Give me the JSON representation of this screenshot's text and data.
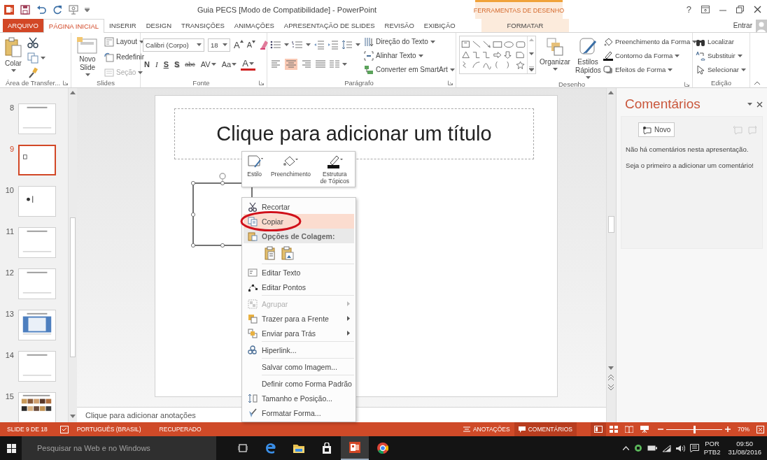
{
  "window": {
    "title": "Guia PECS [Modo de Compatibilidade] - PowerPoint",
    "help": "?",
    "account": "Entrar"
  },
  "contextual_group": {
    "label": "FERRAMENTAS DE DESENHO"
  },
  "tabs": [
    {
      "label": "ARQUIVO",
      "kind": "file",
      "selected": false
    },
    {
      "label": "PÁGINA INICIAL",
      "kind": "tab",
      "selected": true
    },
    {
      "label": "INSERIR",
      "kind": "tab",
      "selected": false
    },
    {
      "label": "DESIGN",
      "kind": "tab",
      "selected": false
    },
    {
      "label": "TRANSIÇÕES",
      "kind": "tab",
      "selected": false
    },
    {
      "label": "ANIMAÇÕES",
      "kind": "tab",
      "selected": false
    },
    {
      "label": "APRESENTAÇÃO DE SLIDES",
      "kind": "tab",
      "selected": false
    },
    {
      "label": "REVISÃO",
      "kind": "tab",
      "selected": false
    },
    {
      "label": "EXIBIÇÃO",
      "kind": "tab",
      "selected": false
    },
    {
      "label": "FORMATAR",
      "kind": "contextual",
      "selected": false
    }
  ],
  "ribbon": {
    "groups": [
      {
        "kind": "clipboard",
        "label": "Área de Transfer...",
        "launcher": true,
        "paste": {
          "label": "Colar",
          "dropdown": true
        }
      },
      {
        "kind": "slides",
        "label": "Slides",
        "launcher": false,
        "new_slide": {
          "label": "Novo Slide",
          "dropdown": true
        },
        "commands": [
          {
            "label": "Layout",
            "dropdown": true,
            "disabled": false
          },
          {
            "label": "Redefinir",
            "dropdown": false,
            "disabled": false
          },
          {
            "label": "Seção",
            "dropdown": true,
            "disabled": true
          }
        ]
      },
      {
        "kind": "font",
        "label": "Fonte",
        "launcher": true,
        "font_name": "Calibri (Corpo)",
        "font_size": "18",
        "size_buttons": [
          "A",
          "A"
        ],
        "format_buttons": [
          "N",
          "I",
          "S",
          "S",
          "abc",
          "AV",
          "Aa",
          "A"
        ]
      },
      {
        "kind": "paragraph",
        "label": "Parágrafo",
        "launcher": true,
        "alignments": [
          {
            "selected": false
          },
          {
            "selected": true
          },
          {
            "selected": false
          },
          {
            "selected": false
          }
        ],
        "commands": [
          {
            "label": "Direção do Texto",
            "dropdown": true
          },
          {
            "label": "Alinhar Texto",
            "dropdown": true
          },
          {
            "label": "Converter em SmartArt",
            "dropdown": true
          }
        ]
      },
      {
        "kind": "drawing",
        "label": "Desenho",
        "launcher": true,
        "large": [
          {
            "label": "Organizar",
            "dropdown": true
          },
          {
            "label": "Estilos Rápidos",
            "dropdown": true
          }
        ],
        "commands": [
          {
            "label": "Preenchimento da Forma",
            "dropdown": true
          },
          {
            "label": "Contorno da Forma",
            "dropdown": true
          },
          {
            "label": "Efeitos de Forma",
            "dropdown": true
          }
        ]
      },
      {
        "kind": "editing",
        "label": "Edição",
        "launcher": false,
        "commands": [
          {
            "label": "Localizar",
            "dropdown": false
          },
          {
            "label": "Substituir",
            "dropdown": true
          },
          {
            "label": "Selecionar",
            "dropdown": true
          }
        ]
      }
    ]
  },
  "slides_pane": {
    "slides": [
      {
        "number": "8",
        "kind": "text",
        "selected": false
      },
      {
        "number": "9",
        "kind": "shape",
        "selected": true
      },
      {
        "number": "10",
        "kind": "icon",
        "selected": false
      },
      {
        "number": "11",
        "kind": "text",
        "selected": false
      },
      {
        "number": "12",
        "kind": "text",
        "selected": false
      },
      {
        "number": "13",
        "kind": "picture",
        "selected": false
      },
      {
        "number": "14",
        "kind": "text",
        "selected": false
      },
      {
        "number": "15",
        "kind": "photos",
        "selected": false
      }
    ]
  },
  "slide": {
    "title_placeholder": "Clique para adicionar um título",
    "shape": {
      "selected": true
    },
    "notes_placeholder": "Clique para adicionar anotações"
  },
  "mini_toolbar": {
    "buttons": [
      {
        "label": "Estilo"
      },
      {
        "label": "Preenchimento"
      },
      {
        "label": "Estrutura de Tópicos"
      }
    ]
  },
  "context_menu": {
    "items": [
      {
        "kind": "item",
        "label": "Recortar",
        "selected": false,
        "disabled": false,
        "submenu": false,
        "circled": false
      },
      {
        "kind": "item",
        "label": "Copiar",
        "selected": true,
        "disabled": false,
        "submenu": false,
        "circled": true
      },
      {
        "kind": "header",
        "label": "Opções de Colagem:"
      },
      {
        "kind": "paste"
      },
      {
        "kind": "separator"
      },
      {
        "kind": "item",
        "label": "Editar Texto",
        "selected": false,
        "disabled": false,
        "submenu": false,
        "circled": false
      },
      {
        "kind": "item",
        "label": "Editar Pontos",
        "selected": false,
        "disabled": false,
        "submenu": false,
        "circled": false
      },
      {
        "kind": "separator"
      },
      {
        "kind": "item",
        "label": "Agrupar",
        "selected": false,
        "disabled": true,
        "submenu": true,
        "circled": false
      },
      {
        "kind": "item",
        "label": "Trazer para a Frente",
        "selected": false,
        "disabled": false,
        "submenu": true,
        "circled": false
      },
      {
        "kind": "item",
        "label": "Enviar para Trás",
        "selected": false,
        "disabled": false,
        "submenu": true,
        "circled": false
      },
      {
        "kind": "separator"
      },
      {
        "kind": "item",
        "label": "Hiperlink...",
        "selected": false,
        "disabled": false,
        "submenu": false,
        "circled": false
      },
      {
        "kind": "separator"
      },
      {
        "kind": "item",
        "label": "Salvar como Imagem...",
        "selected": false,
        "disabled": false,
        "submenu": false,
        "circled": false
      },
      {
        "kind": "separator"
      },
      {
        "kind": "item",
        "label": "Definir como Forma Padrão",
        "selected": false,
        "disabled": false,
        "submenu": false,
        "circled": false
      },
      {
        "kind": "item",
        "label": "Tamanho e Posição...",
        "selected": false,
        "disabled": false,
        "submenu": false,
        "circled": false
      },
      {
        "kind": "item",
        "label": "Formatar Forma...",
        "selected": false,
        "disabled": false,
        "submenu": false,
        "circled": false
      }
    ]
  },
  "comments_pane": {
    "title": "Comentários",
    "new_button": "Novo",
    "messages": [
      "Não há comentários nesta apresentação.",
      "Seja o primeiro a adicionar um comentário!"
    ]
  },
  "status_bar": {
    "slide_info": "SLIDE 9 DE 18",
    "language": "PORTUGUÊS (BRASIL)",
    "state": "RECUPERADO",
    "notes": {
      "label": "ANOTAÇÕES",
      "selected": false
    },
    "comments": {
      "label": "COMENTÁRIOS",
      "selected": true
    },
    "views": [
      {
        "selected": true
      },
      {
        "selected": false
      },
      {
        "selected": false
      },
      {
        "selected": false
      }
    ],
    "zoom": {
      "level": 0.5,
      "reading": "70%"
    }
  },
  "taskbar": {
    "search_placeholder": "Pesquisar na Web e no Windows",
    "apps": [
      {
        "active": false
      },
      {
        "active": false
      },
      {
        "active": false
      },
      {
        "active": false
      },
      {
        "active": true
      },
      {
        "active": false
      }
    ],
    "tray": {
      "language": "POR",
      "layout": "PTB2",
      "time": "09:50",
      "date": "31/08/2016"
    }
  }
}
